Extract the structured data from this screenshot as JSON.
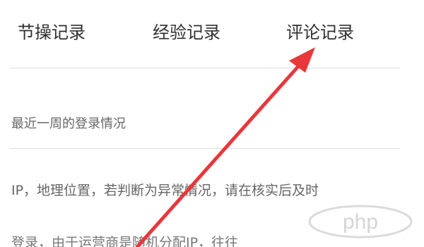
{
  "tabs": [
    {
      "label": "节操记录"
    },
    {
      "label": "经验记录"
    },
    {
      "label": "评论记录"
    }
  ],
  "content": {
    "line1": "最近一周的登录情况",
    "line2": "IP，地理位置，若判断为异常情况，请在核实后及时",
    "line3": "登录，由于运营商是随机分配IP，往往"
  },
  "watermark": {
    "text": "php"
  },
  "annotation": {
    "color": "#e8373b"
  }
}
